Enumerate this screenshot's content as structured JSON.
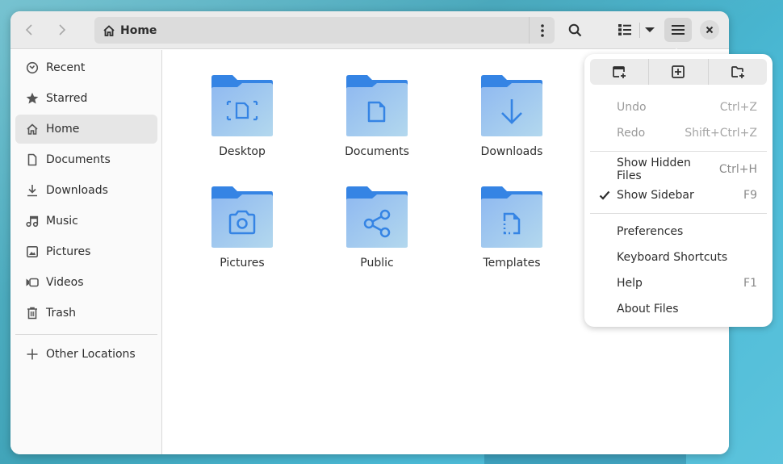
{
  "headerbar": {
    "path_label": "Home",
    "back_icon": "chevron-left-icon",
    "forward_icon": "chevron-right-icon"
  },
  "sidebar": {
    "items": [
      {
        "label": "Recent",
        "icon": "clock-icon"
      },
      {
        "label": "Starred",
        "icon": "star-icon"
      },
      {
        "label": "Home",
        "icon": "home-icon",
        "active": true
      },
      {
        "label": "Documents",
        "icon": "document-icon"
      },
      {
        "label": "Downloads",
        "icon": "download-icon"
      },
      {
        "label": "Music",
        "icon": "music-icon"
      },
      {
        "label": "Pictures",
        "icon": "image-icon"
      },
      {
        "label": "Videos",
        "icon": "video-icon"
      },
      {
        "label": "Trash",
        "icon": "trash-icon"
      }
    ],
    "other_locations": "Other Locations"
  },
  "folders": [
    {
      "label": "Desktop",
      "icon": "desktop-folder-icon"
    },
    {
      "label": "Documents",
      "icon": "documents-folder-icon"
    },
    {
      "label": "Downloads",
      "icon": "downloads-folder-icon"
    },
    {
      "label": "Pictures",
      "icon": "pictures-folder-icon"
    },
    {
      "label": "Public",
      "icon": "public-folder-icon"
    },
    {
      "label": "Templates",
      "icon": "templates-folder-icon"
    }
  ],
  "menu": {
    "top_buttons": [
      "new-window-icon",
      "new-tab-icon",
      "new-folder-icon"
    ],
    "items": [
      {
        "label": "Undo",
        "accel": "Ctrl+Z",
        "disabled": true
      },
      {
        "label": "Redo",
        "accel": "Shift+Ctrl+Z",
        "disabled": true
      },
      {
        "label": "Show Hidden Files",
        "accel": "Ctrl+H"
      },
      {
        "label": "Show Sidebar",
        "accel": "F9",
        "checked": true
      },
      {
        "label": "Preferences",
        "accel": ""
      },
      {
        "label": "Keyboard Shortcuts",
        "accel": ""
      },
      {
        "label": "Help",
        "accel": "F1"
      },
      {
        "label": "About Files",
        "accel": ""
      }
    ]
  },
  "colors": {
    "folder_back": "#3584e4",
    "folder_front": "#99c1f1",
    "folder_glyph": "#3584e4"
  }
}
